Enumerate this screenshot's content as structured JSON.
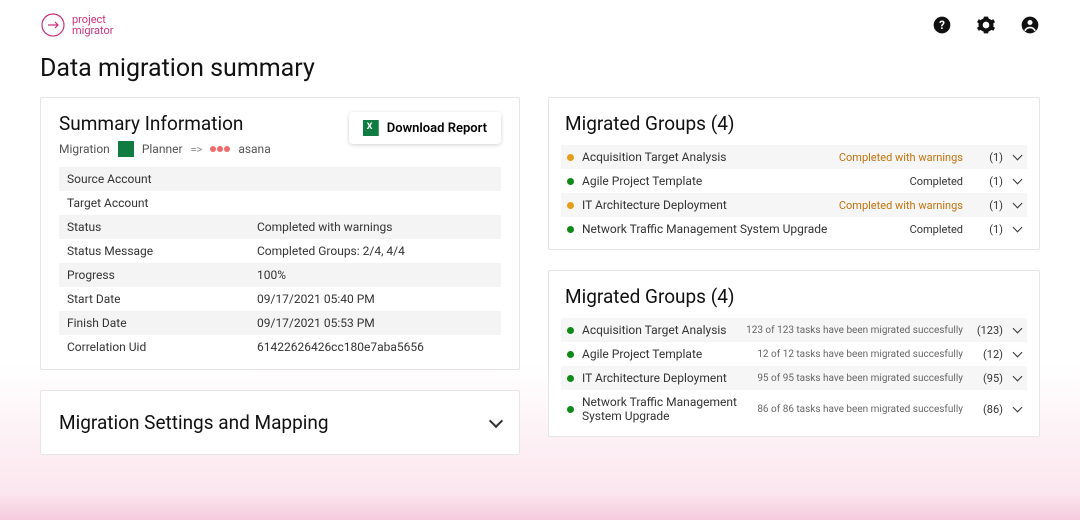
{
  "header": {
    "logo_top": "project",
    "logo_bottom": "migrator"
  },
  "page_title": "Data migration summary",
  "summary": {
    "title": "Summary Information",
    "download_label": "Download Report",
    "migration_label": "Migration",
    "source_app_label": "Planner",
    "arrow": "=>",
    "target_app_label": "asana",
    "rows": [
      {
        "k": "Source Account",
        "v": ""
      },
      {
        "k": "Target Account",
        "v": ""
      },
      {
        "k": "Status",
        "v": "Completed with warnings"
      },
      {
        "k": "Status Message",
        "v": "Completed Groups: 2/4, 4/4"
      },
      {
        "k": "Progress",
        "v": "100%"
      },
      {
        "k": "Start Date",
        "v": "09/17/2021 05:40 PM"
      },
      {
        "k": "Finish Date",
        "v": "09/17/2021 05:53 PM"
      },
      {
        "k": "Correlation Uid",
        "v": "61422626426cc180e7aba5656"
      }
    ]
  },
  "settings_card_title": "Migration Settings and Mapping",
  "groups_title": "Migrated Groups (4)",
  "groups_status": [
    {
      "dot": "orange",
      "name": "Acquisition Target Analysis",
      "status": "Completed with warnings",
      "status_class": "warn",
      "count": "(1)"
    },
    {
      "dot": "green",
      "name": "Agile Project Template",
      "status": "Completed",
      "status_class": "ok",
      "count": "(1)"
    },
    {
      "dot": "orange",
      "name": "IT Architecture Deployment",
      "status": "Completed with warnings",
      "status_class": "warn",
      "count": "(1)"
    },
    {
      "dot": "green",
      "name": "Network Traffic Management System Upgrade",
      "status": "Completed",
      "status_class": "ok",
      "count": "(1)"
    }
  ],
  "groups_tasks": [
    {
      "dot": "green",
      "name": "Acquisition Target Analysis",
      "sub": "123 of 123 tasks have been migrated succesfully",
      "count": "(123)"
    },
    {
      "dot": "green",
      "name": "Agile Project Template",
      "sub": "12 of 12 tasks have been migrated succesfully",
      "count": "(12)"
    },
    {
      "dot": "green",
      "name": "IT Architecture Deployment",
      "sub": "95 of 95 tasks have been migrated succesfully",
      "count": "(95)"
    },
    {
      "dot": "green",
      "name": "Network Traffic Management System Upgrade",
      "sub": "86 of 86 tasks have been migrated succesfully",
      "count": "(86)"
    }
  ]
}
